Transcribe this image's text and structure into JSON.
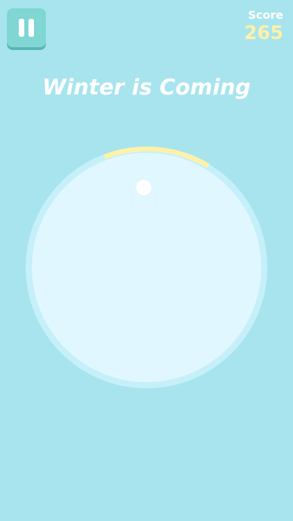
{
  "hud": {
    "score_label": "Score",
    "score_value": "265"
  },
  "level": {
    "title": "Winter is Coming"
  },
  "colors": {
    "background": "#a8e4ee",
    "ring": "#c6f0f9",
    "inner": "#e1f7ff",
    "arc": "#fff1a8",
    "ball": "#ffffff",
    "button": "#7fd6d2",
    "score": "#fff1a8"
  },
  "icons": {
    "pause": "pause-icon"
  }
}
